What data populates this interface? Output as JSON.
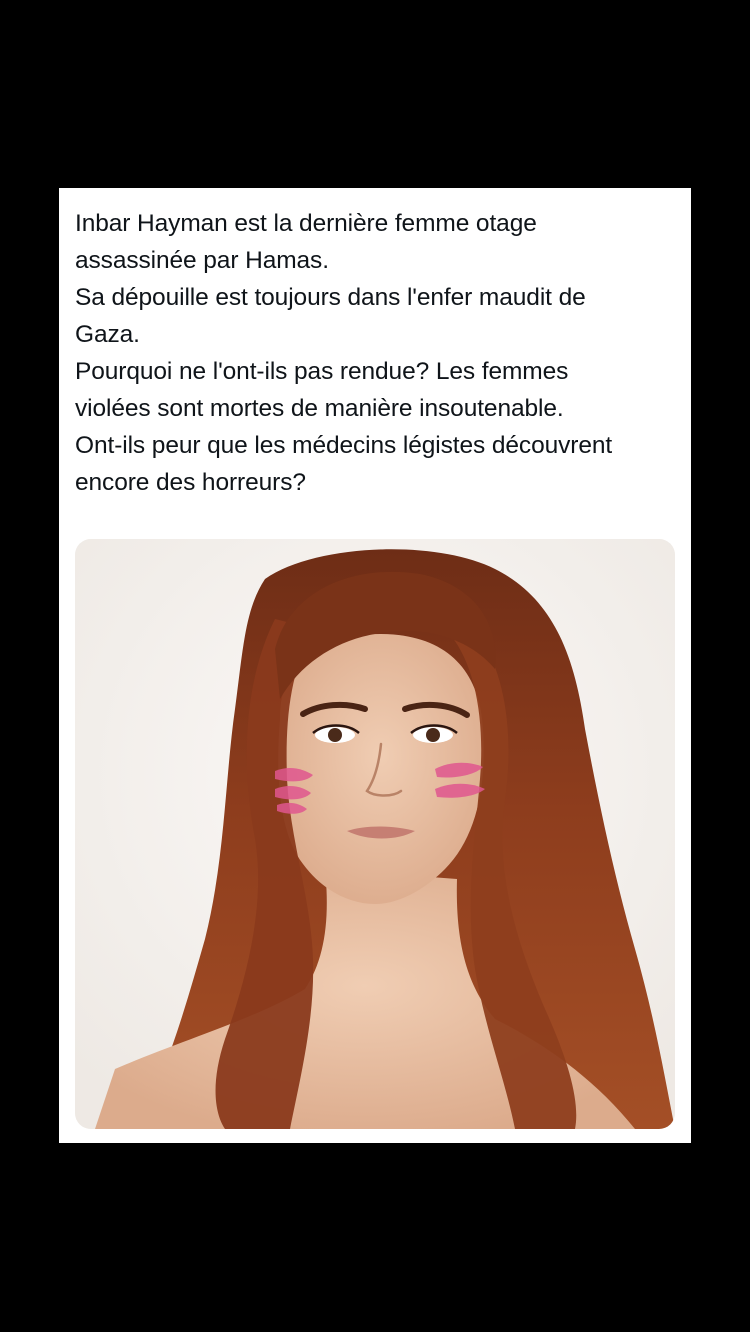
{
  "tweet": {
    "text_lines": [
      "Inbar Hayman est la dernière femme otage",
      "assassinée par Hamas.",
      "Sa dépouille est toujours dans l'enfer maudit de",
      "Gaza.",
      "Pourquoi ne l'ont-ils pas rendue? Les femmes",
      "violées sont mortes de manière insoutenable.",
      "Ont-ils peur que les médecins légistes découvrent",
      "encore des horreurs?"
    ]
  },
  "media": {
    "subject": "portrait photo of a young woman with long auburn hair and pink stripes painted on her cheeks",
    "colors": {
      "background": "#f6f3f0",
      "hair": "#8a3a1c",
      "skin": "#e9c3a8",
      "paint": "#e0578f"
    }
  },
  "colors": {
    "page_background": "#000000",
    "card_background": "#ffffff",
    "text": "#0f1419"
  }
}
